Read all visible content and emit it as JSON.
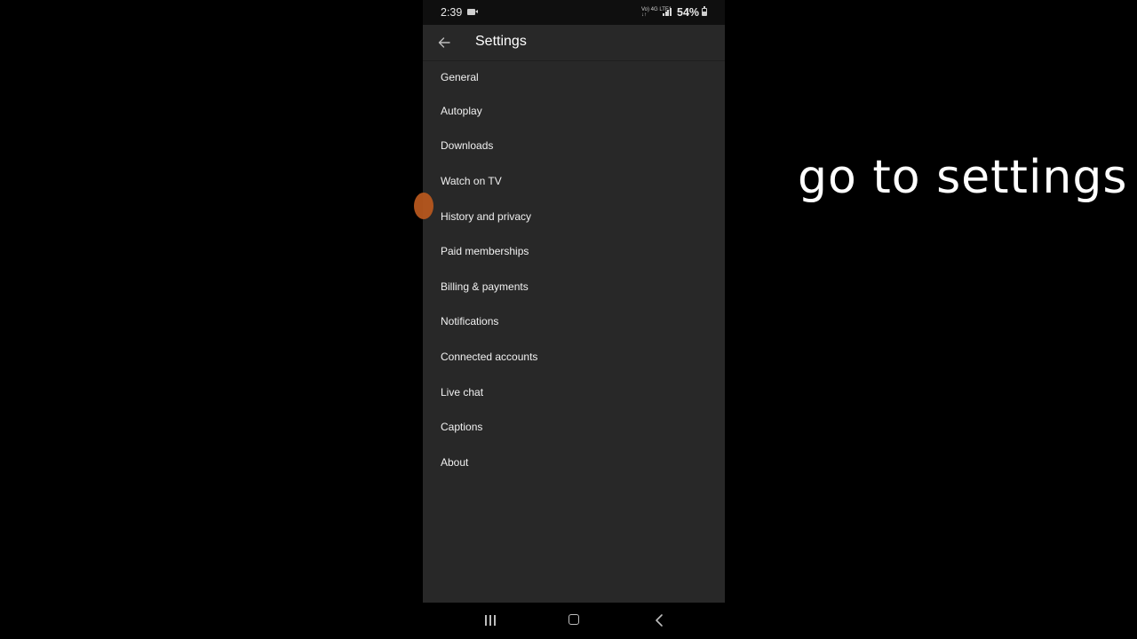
{
  "status_bar": {
    "time": "2:39",
    "network_text": "Vo) 4G LTE1 ↓↑",
    "battery": "54%"
  },
  "header": {
    "title": "Settings",
    "back_icon": "arrow-left-icon"
  },
  "menu": {
    "items": [
      {
        "label": "General"
      },
      {
        "label": "Autoplay"
      },
      {
        "label": "Downloads"
      },
      {
        "label": "Watch on TV"
      },
      {
        "label": "History and privacy"
      },
      {
        "label": "Paid memberships"
      },
      {
        "label": "Billing & payments"
      },
      {
        "label": "Notifications"
      },
      {
        "label": "Connected accounts"
      },
      {
        "label": "Live chat"
      },
      {
        "label": "Captions"
      },
      {
        "label": "About"
      }
    ]
  },
  "caption": {
    "text": "go to settings"
  },
  "colors": {
    "background": "#000000",
    "app_surface": "#282828",
    "text": "#f1f1f1",
    "touch_indicator": "#b5561d"
  }
}
